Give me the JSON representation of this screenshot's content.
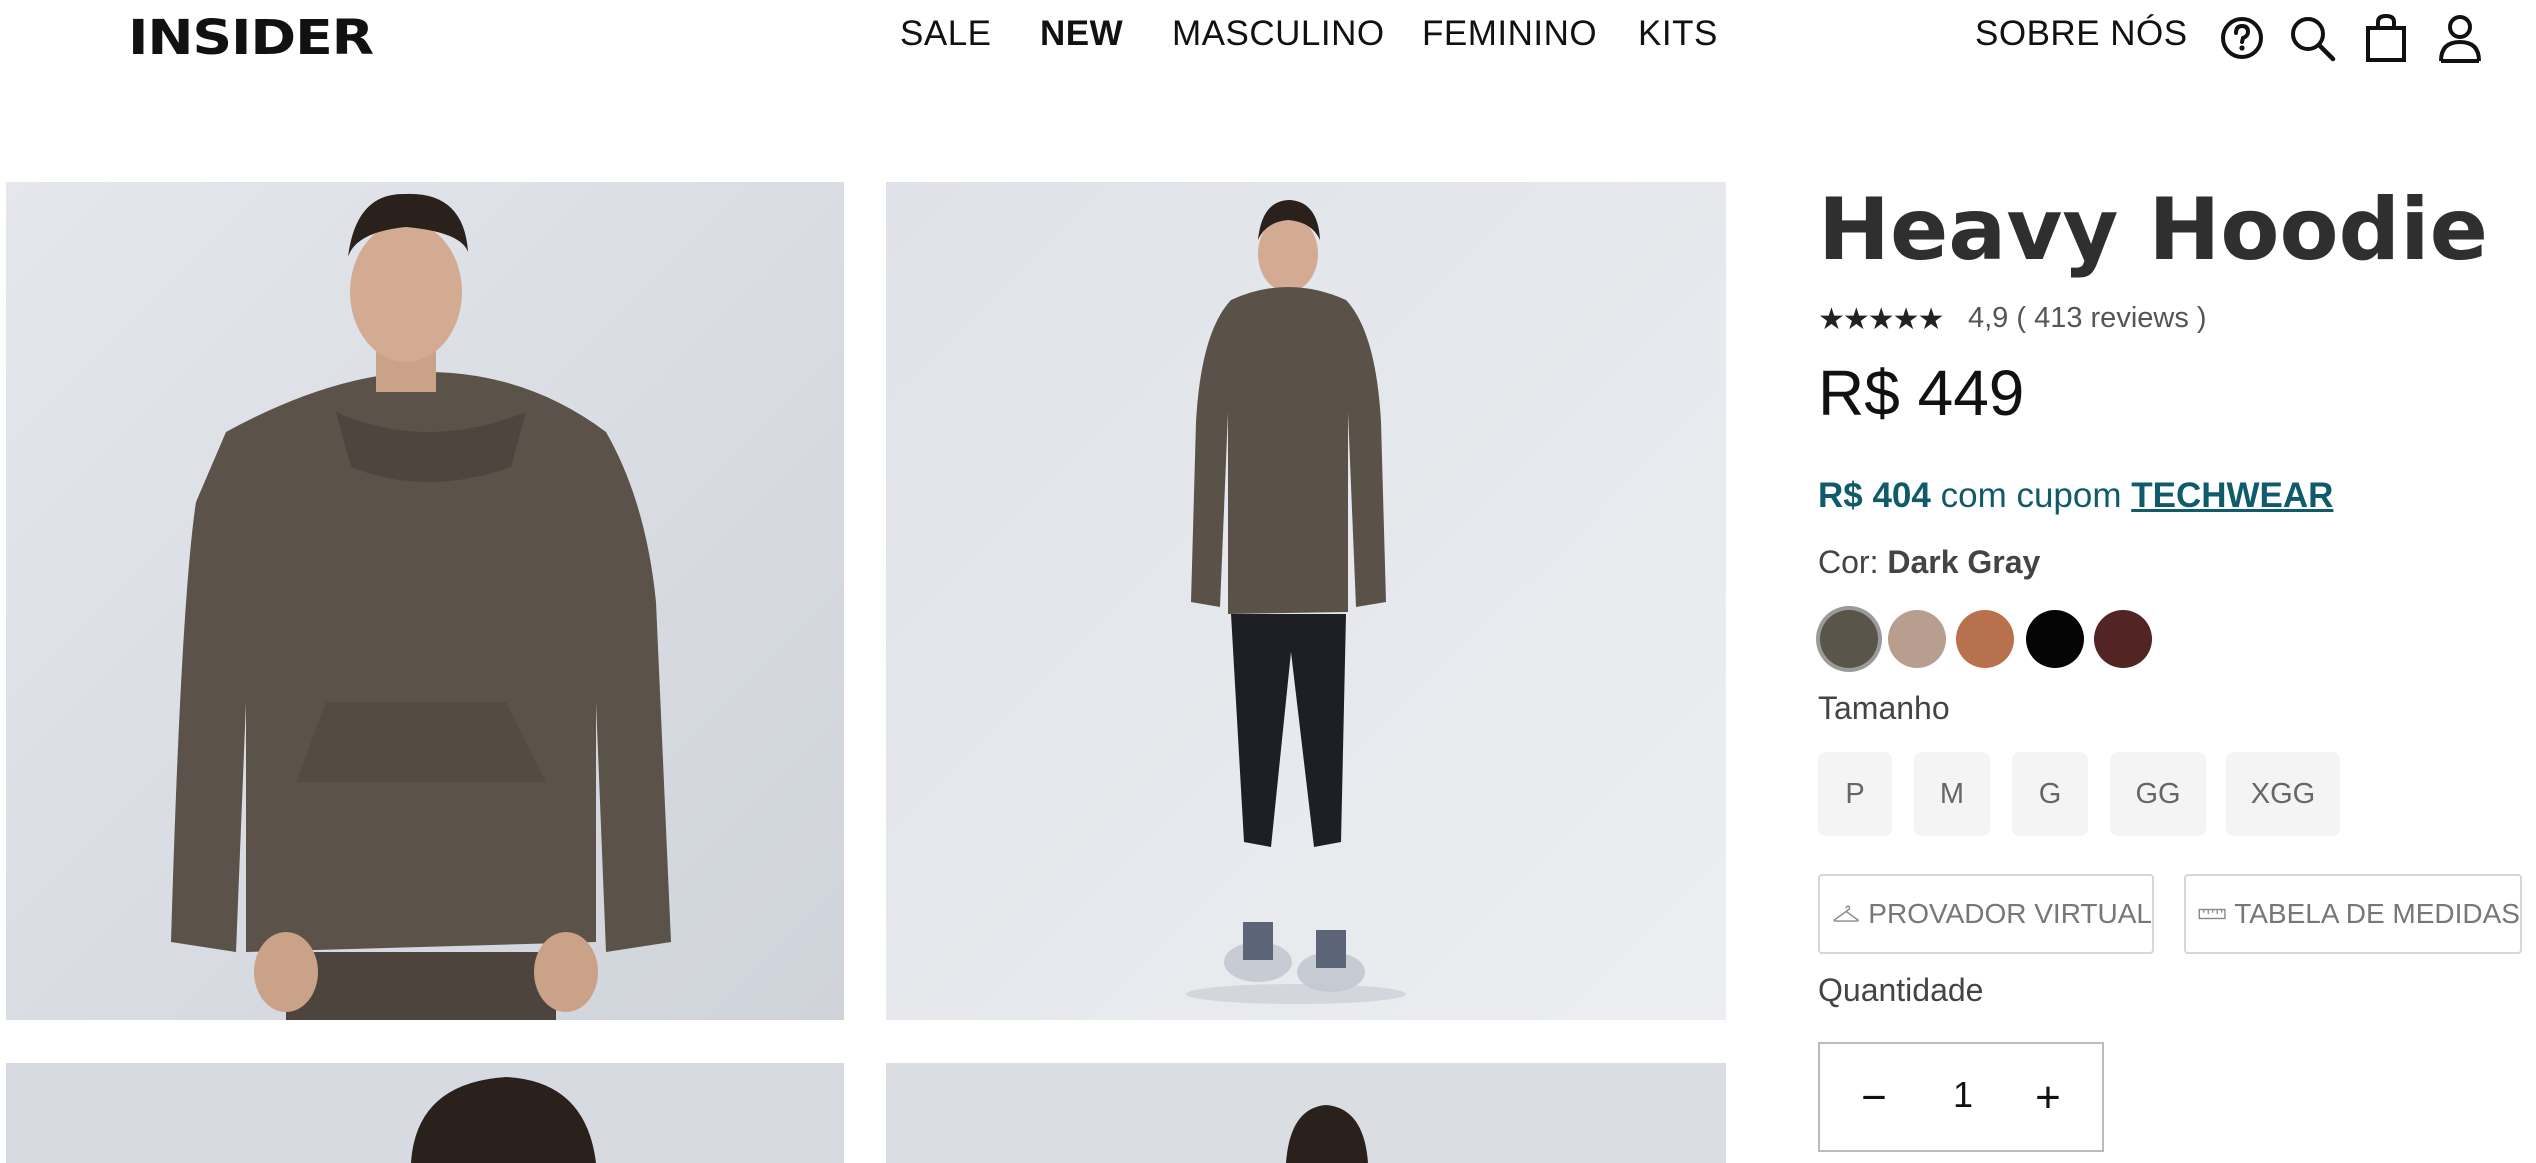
{
  "header": {
    "logo": "INSIDER",
    "nav": [
      "SALE",
      "NEW",
      "MASCULINO",
      "FEMININO",
      "KITS"
    ],
    "about": "SOBRE NÓS"
  },
  "icons": {
    "help": "question-circle-icon",
    "search": "search-icon",
    "cart": "shopping-bag-icon",
    "account": "user-icon"
  },
  "product": {
    "title": "Heavy Hoodie",
    "stars": "★★★★★",
    "rating_text": "4,9 ( 413 reviews )",
    "price": "R$ 449",
    "coupon": {
      "price": "R$ 404",
      "text": " com cupom ",
      "code": "TECHWEAR"
    },
    "color_label": "Cor: ",
    "color_value": "Dark Gray",
    "colors": [
      "#595549",
      "#b79e8f",
      "#b7714c",
      "#050505",
      "#522423"
    ],
    "size_label": "Tamanho",
    "sizes": [
      "P",
      "M",
      "G",
      "GG",
      "XGG"
    ],
    "virtual_fitting": "PROVADOR VIRTUAL",
    "size_chart": "TABELA DE MEDIDAS",
    "quantity_label": "Quantidade",
    "quantity": "1",
    "minus": "−",
    "plus": "+"
  }
}
